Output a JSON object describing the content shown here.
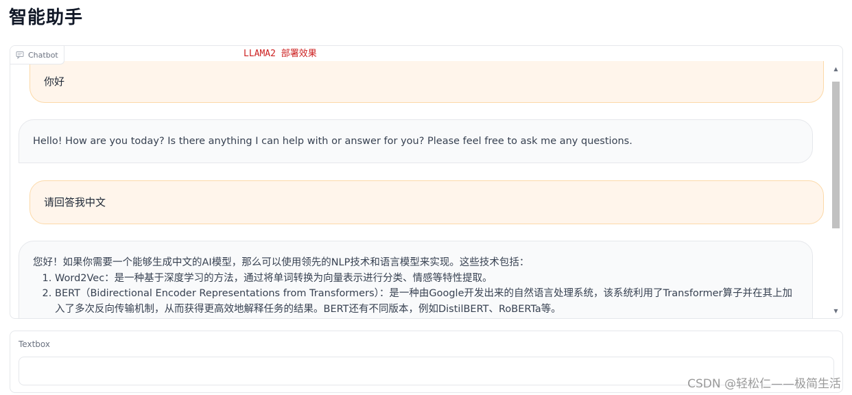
{
  "page": {
    "title": "智能助手"
  },
  "annotation": "LLAMA2 部署效果",
  "chatbot": {
    "label": "Chatbot",
    "label_icon": "chat-bubble-icon",
    "messages": [
      {
        "role": "user",
        "text": "你好"
      },
      {
        "role": "bot",
        "text": "Hello! How are you today? Is there anything I can help with or answer for you? Please feel free to ask me any questions."
      },
      {
        "role": "user",
        "text": "请回答我中文"
      },
      {
        "role": "bot",
        "intro": "您好！如果你需要一个能够生成中文的AI模型，那么可以使用领先的NLP技术和语言模型来实现。这些技术包括：",
        "items": [
          "Word2Vec：是一种基于深度学习的方法，通过将单词转换为向量表示进行分类、情感等特性提取。",
          "BERT（Bidirectional Encoder Representations from Transformers）：是一种由Google开发出来的自然语言处理系统，该系统利用了Transformer算子并在其上加入了多次反向传输机制，从而获得更高效地解释任务的结果。BERT还有不同版本，例如DistilBERT、RoBERTa等。"
        ]
      }
    ]
  },
  "textbox": {
    "label": "Textbox",
    "value": "",
    "placeholder": ""
  },
  "watermark": "CSDN @轻松仁——极简生活",
  "colors": {
    "user_bubble": "#fff5eb",
    "user_border": "#fcd9a8",
    "bot_bubble": "#f9fafb",
    "annotation": "#cc1f1f"
  }
}
